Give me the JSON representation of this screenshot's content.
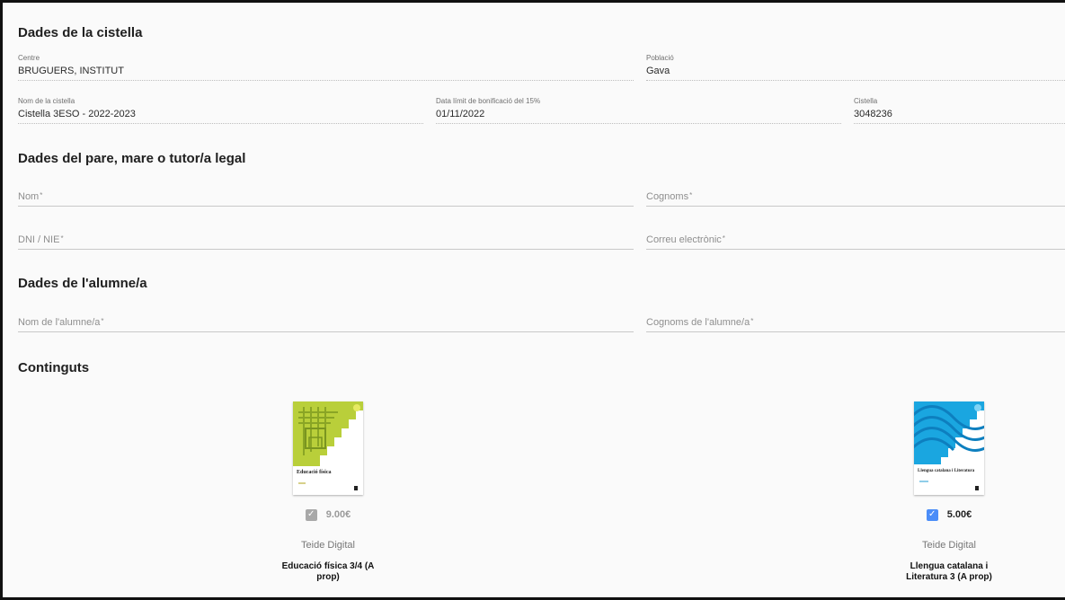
{
  "sections": {
    "basket": "Dades de la cistella",
    "parent": "Dades del pare, mare o tutor/a legal",
    "student": "Dades de l'alumne/a",
    "contents": "Continguts"
  },
  "basket_fields": {
    "centre": {
      "label": "Centre",
      "value": "BRUGUERS, INSTITUT"
    },
    "poblacio": {
      "label": "Població",
      "value": "Gava"
    },
    "nom_cistella": {
      "label": "Nom de la cistella",
      "value": "Cistella 3ESO - 2022-2023"
    },
    "data_limit": {
      "label": "Data límit de bonificació del 15%",
      "value": "01/11/2022"
    },
    "cistella": {
      "label": "Cistella",
      "value": "3048236"
    }
  },
  "parent_fields": {
    "nom": "Nom",
    "cognoms": "Cognoms",
    "dni": "DNI / NIE",
    "email": "Correu electrònic"
  },
  "student_fields": {
    "nom": "Nom de l'alumne/a",
    "cognoms": "Cognoms de l'alumne/a"
  },
  "required_mark": "*",
  "products": [
    {
      "price": "9.00€",
      "checked": true,
      "disabled": true,
      "publisher": "Teide Digital",
      "title": "Educació física 3/4 (A prop)",
      "cover_title": "Educació física",
      "cover_color": "#b9cf3a"
    },
    {
      "price": "5.00€",
      "checked": true,
      "disabled": false,
      "publisher": "Teide Digital",
      "title": "Llengua catalana i Literatura 3 (A prop)",
      "cover_title": "Llengua catalana i Literatura",
      "cover_color": "#1aa6e0"
    }
  ],
  "icons": {
    "checkbox": "check-icon"
  }
}
